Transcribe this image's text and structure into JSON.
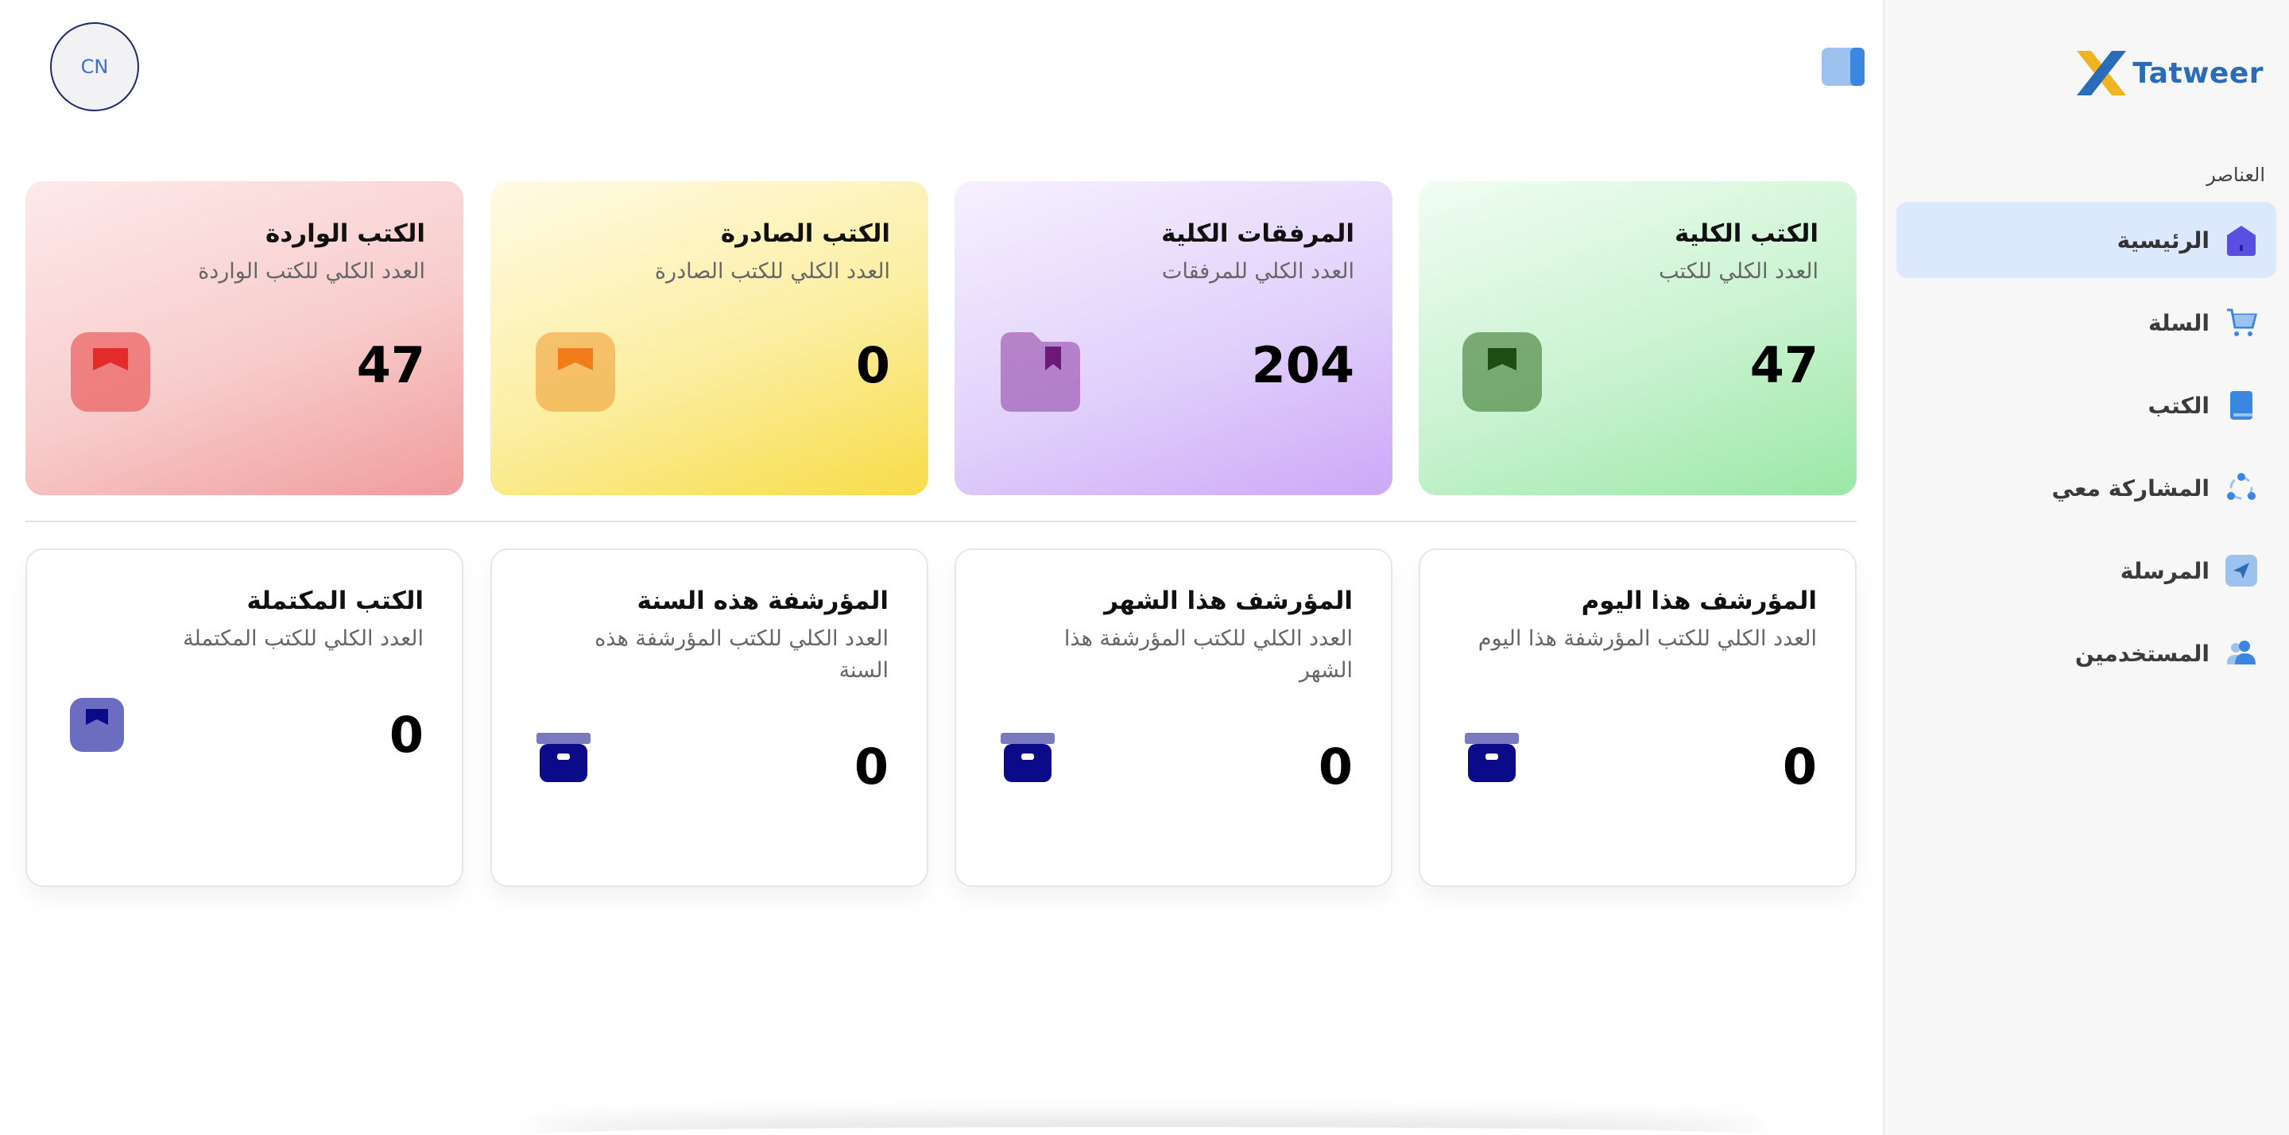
{
  "app": {
    "logo_text": "Tatweer",
    "avatar_initials": "CN"
  },
  "sidebar": {
    "section_label": "العناصر",
    "items": [
      {
        "label": "الرئيسية",
        "icon": "home-icon",
        "active": true
      },
      {
        "label": "السلة",
        "icon": "cart-icon",
        "active": false
      },
      {
        "label": "الكتب",
        "icon": "book-icon",
        "active": false
      },
      {
        "label": "المشاركة معي",
        "icon": "share-icon",
        "active": false
      },
      {
        "label": "المرسلة",
        "icon": "send-icon",
        "active": false
      },
      {
        "label": "المستخدمين",
        "icon": "users-icon",
        "active": false
      }
    ]
  },
  "stats_top": [
    {
      "title": "الكتب الكلية",
      "subtitle": "العدد الكلي للكتب",
      "value": "47",
      "icon": "book-box-icon",
      "color": "#2e6b1f"
    },
    {
      "title": "المرفقات الكلية",
      "subtitle": "العدد الكلي للمرفقات",
      "value": "204",
      "icon": "folder-icon",
      "color": "#6b1a7a"
    },
    {
      "title": "الكتب الصادرة",
      "subtitle": "العدد الكلي للكتب الصادرة",
      "value": "0",
      "icon": "outbox-icon",
      "color": "#f07d1a"
    },
    {
      "title": "الكتب الواردة",
      "subtitle": "العدد الكلي للكتب الواردة",
      "value": "47",
      "icon": "inbox-icon",
      "color": "#e32b2b"
    }
  ],
  "stats_bottom": [
    {
      "title": "المؤرشف هذا اليوم",
      "subtitle": "العدد الكلي للكتب المؤرشفة هذا اليوم",
      "value": "0",
      "icon": "archive-icon"
    },
    {
      "title": "المؤرشف هذا الشهر",
      "subtitle": "العدد الكلي للكتب المؤرشفة هذا الشهر",
      "value": "0",
      "icon": "archive-icon"
    },
    {
      "title": "المؤرشفة هذه السنة",
      "subtitle": "العدد الكلي للكتب المؤرشفة هذه السنة",
      "value": "0",
      "icon": "archive-icon"
    },
    {
      "title": "الكتب المكتملة",
      "subtitle": "العدد الكلي للكتب المكتملة",
      "value": "0",
      "icon": "completed-box-icon"
    }
  ],
  "colors": {
    "accent": "#2b6cb8",
    "navy": "#0b0b8a",
    "active_bg": "#dce8fb"
  }
}
